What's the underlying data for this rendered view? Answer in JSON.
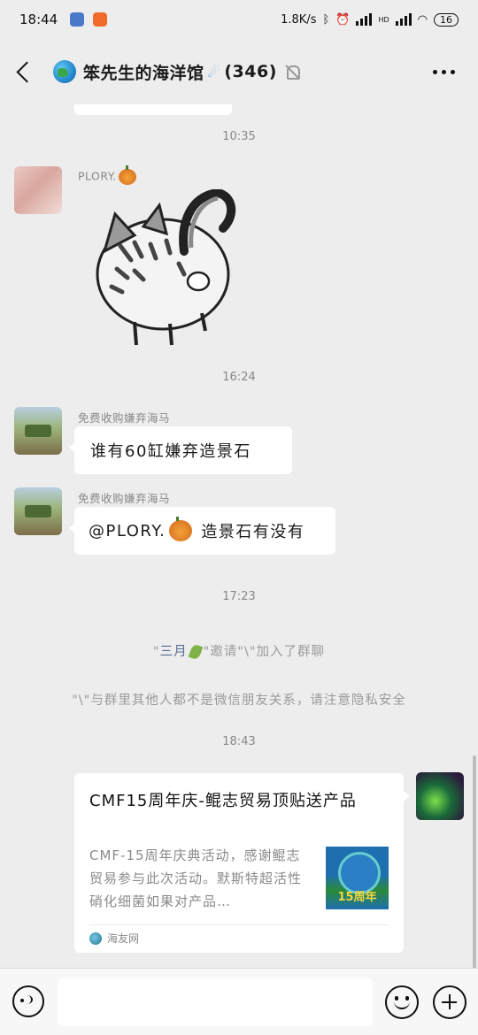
{
  "status_bar": {
    "time": "18:44",
    "net_speed": "1.8K/s",
    "network_badge": "HD",
    "battery": "16"
  },
  "header": {
    "title": "笨先生的海洋馆",
    "member_count": "(346)"
  },
  "messages": {
    "t1": "10:35",
    "plory_sender": "PLORY.",
    "t2": "16:24",
    "m1_sender": "免费收购嫌弃海马",
    "m1_text": "谁有60缸嫌弃造景石",
    "m2_sender": "免费收购嫌弃海马",
    "m2_mention": "@PLORY.",
    "m2_text": "造景石有没有",
    "t3": "17:23",
    "sys_name": "三月",
    "sys_rest": "\"邀请\"\\\"加入了群聊",
    "privacy_notice": "\"\\\"与群里其他人都不是微信朋友关系，请注意隐私安全",
    "t4": "18:43"
  },
  "card": {
    "title": "CMF15周年庆-鲲志贸易顶贴送产品",
    "description": "CMF-15周年庆典活动，感谢鲲志贸易参与此次活动。默斯特超活性硝化细菌如果对产品…",
    "thumb_label": "15周年",
    "source": "海友网"
  },
  "icons": {
    "back": "back-arrow-icon",
    "more": "more-dots-icon",
    "voice": "voice-icon",
    "emoji": "emoji-icon",
    "add": "add-icon"
  }
}
